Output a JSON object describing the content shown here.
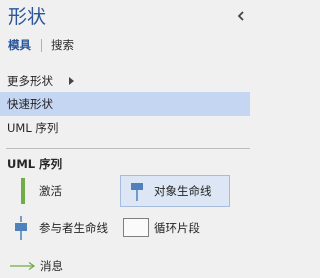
{
  "panel": {
    "title": "形状",
    "collapse_icon": "chevron-left-icon"
  },
  "tabs": [
    {
      "label": "模具",
      "active": true
    },
    {
      "label": "搜索",
      "active": false
    }
  ],
  "menu": {
    "more_shapes": "更多形状",
    "quick_shapes": "快速形状",
    "uml_sequence": "UML 序列"
  },
  "section": {
    "title": "UML 序列",
    "shapes": [
      {
        "label": "激活",
        "icon": "activation-icon"
      },
      {
        "label": "对象生命线",
        "icon": "object-lifeline-icon",
        "selected": true
      },
      {
        "label": "参与者生命线",
        "icon": "actor-lifeline-icon"
      },
      {
        "label": "循环片段",
        "icon": "loop-fragment-icon"
      },
      {
        "label": "消息",
        "icon": "message-arrow-icon"
      }
    ]
  },
  "colors": {
    "accent": "#2b579a",
    "selected_menu": "#c5d6f2",
    "selected_shape": "#dce6f4",
    "activation_green": "#70ad47",
    "lifeline_blue": "#4f81bd"
  }
}
